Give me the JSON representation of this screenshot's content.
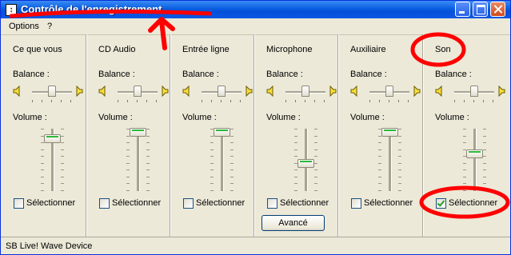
{
  "window": {
    "title": "Contrôle de l'enregistrement",
    "icon": "mixer-app-icon",
    "controls": [
      "minimize",
      "maximize",
      "close"
    ]
  },
  "menu": [
    {
      "label": "Options"
    },
    {
      "label": "?"
    }
  ],
  "labels": {
    "balance": "Balance :",
    "volume": "Volume :",
    "select": "Sélectionner"
  },
  "columns": [
    {
      "name": "Ce que vous",
      "volume": 0.85,
      "balance": 0.5,
      "selected": false
    },
    {
      "name": "CD Audio",
      "volume": 0.95,
      "balance": 0.5,
      "selected": false
    },
    {
      "name": "Entrée ligne",
      "volume": 0.95,
      "balance": 0.5,
      "selected": false
    },
    {
      "name": "Microphone",
      "volume": 0.45,
      "balance": 0.5,
      "selected": false
    },
    {
      "name": "Auxiliaire",
      "volume": 0.95,
      "balance": 0.5,
      "selected": false
    },
    {
      "name": "Son",
      "volume": 0.6,
      "balance": 0.5,
      "selected": true
    }
  ],
  "advanced_button": "Avancé",
  "status": "SB Live! Wave Device",
  "annotation_color": "#ff0000"
}
